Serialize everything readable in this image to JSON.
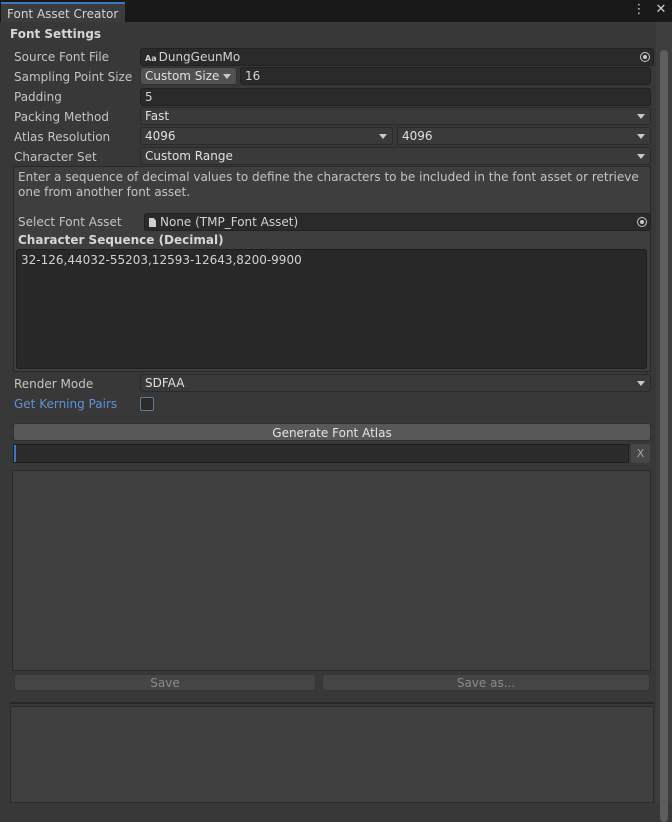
{
  "window": {
    "tab_title": "Font Asset Creator",
    "menu_icon": "kebab-menu-icon",
    "close_icon": "close-icon"
  },
  "font_settings": {
    "section_title": "Font Settings",
    "source_font_file": {
      "label": "Source Font File",
      "value": "DungGeunMo",
      "icon": "font-asset-icon"
    },
    "sampling_point_size": {
      "label": "Sampling Point Size",
      "mode": "Custom Size",
      "value": "16"
    },
    "padding": {
      "label": "Padding",
      "value": "5"
    },
    "packing_method": {
      "label": "Packing Method",
      "value": "Fast"
    },
    "atlas_resolution": {
      "label": "Atlas Resolution",
      "width": "4096",
      "height": "4096"
    },
    "character_set": {
      "label": "Character Set",
      "value": "Custom Range"
    },
    "help_text": "Enter a sequence of decimal values to define the characters to be included in the font asset or retrieve one from another font asset.",
    "select_font_asset": {
      "label": "Select Font Asset",
      "value": "None (TMP_Font Asset)"
    },
    "character_sequence": {
      "label": "Character Sequence (Decimal)",
      "value": "32-126,44032-55203,12593-12643,8200-9900"
    },
    "render_mode": {
      "label": "Render Mode",
      "value": "SDFAA"
    },
    "get_kerning_pairs": {
      "label": "Get Kerning Pairs",
      "checked": false
    }
  },
  "actions": {
    "generate_label": "Generate Font Atlas",
    "progress": 0.0,
    "cancel_label": "X",
    "save_label": "Save",
    "save_as_label": "Save as..."
  },
  "colors": {
    "accent": "#3a79bb",
    "link_label": "#5d93d8"
  }
}
